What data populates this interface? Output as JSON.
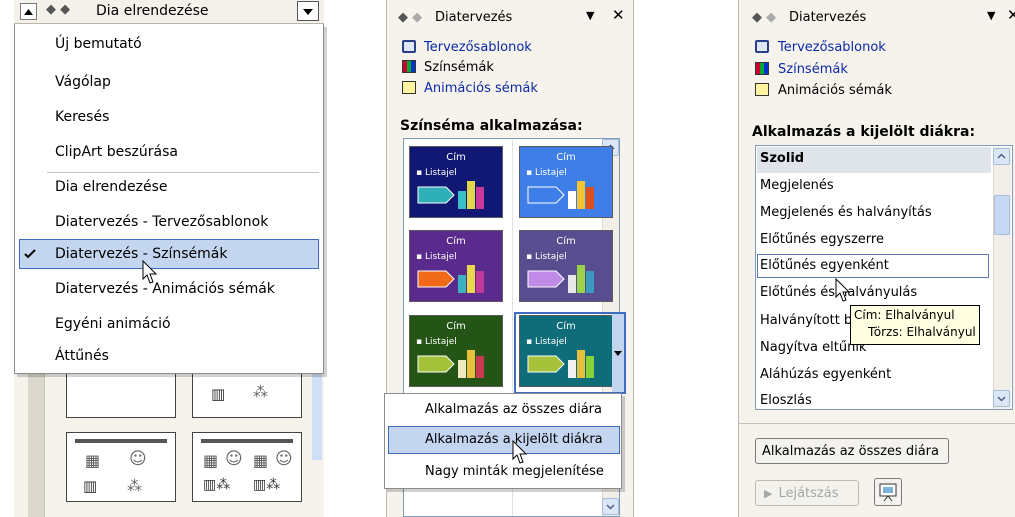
{
  "panel1": {
    "title": "Dia elrendezése",
    "menu_items": [
      "Új bemutató",
      "Vágólap",
      "Keresés",
      "ClipArt beszúrása",
      "Dia elrendezése",
      "Diatervezés - Tervezősablonok",
      "Diatervezés - Színsémák",
      "Diatervezés - Animációs sémák",
      "Egyéni animáció",
      "Áttűnés"
    ],
    "checked_index": 6
  },
  "panel2": {
    "header_title": "Diatervezés",
    "links": [
      "Tervezősablonok",
      "Színsémák",
      "Animációs sémák"
    ],
    "section_title": "Színséma alkalmazása:",
    "tile_title": "Cím",
    "tile_bullet": "Listajel",
    "context_menu": [
      "Alkalmazás az összes diára",
      "Alkalmazás a kijelölt diákra",
      "Nagy minták megjelenítése"
    ],
    "tiles": [
      {
        "bg": "#101873",
        "arrow": "#2fb0b8",
        "bars": [
          "#39c0c8",
          "#e0d84a",
          "#c83a9a"
        ]
      },
      {
        "bg": "#3f7ee6",
        "arrow": "#3f7ee6",
        "bars": [
          "#ffffff",
          "#f4c430",
          "#d9501f"
        ]
      },
      {
        "bg": "#5a2a8c",
        "arrow": "#f06a1a",
        "bars": [
          "#3ab0c0",
          "#e8d84a",
          "#c03a9a"
        ]
      },
      {
        "bg": "#584d8e",
        "arrow": "#c08ae8",
        "bars": [
          "#e8e8e8",
          "#9ad24a",
          "#3a9ac0"
        ]
      },
      {
        "bg": "#245416",
        "arrow": "#a6c23a",
        "bars": [
          "#f0e8c0",
          "#e8c040",
          "#c83a50"
        ]
      },
      {
        "bg": "#0f6d7a",
        "arrow": "#a6c23a",
        "bars": [
          "#f0f0f0",
          "#e8c040",
          "#8ad23a"
        ]
      }
    ]
  },
  "panel3": {
    "header_title": "Diatervezés",
    "links": [
      "Tervezősablonok",
      "Színsémák",
      "Animációs sémák"
    ],
    "section_title": "Alkalmazás a kijelölt diákra:",
    "list_items": [
      "Szolid",
      "Megjelenés",
      "Megjelenés és halványítás",
      "Előtűnés egyszerre",
      "Előtűnés egyenként",
      "Előtűnés és halványulás",
      "Halványított betűk",
      "Nagyítva eltűnik",
      "Aláhúzás egyenként",
      "Eloszlás"
    ],
    "tooltip": [
      "Cím: Elhalványul",
      "Törzs: Elhalványul"
    ],
    "apply_all_button": "Alkalmazás az összes diára",
    "play_button": "Lejátszás"
  },
  "colors": {
    "selection": "#c4d5ef",
    "selection_border": "#3d6cc0",
    "link": "#0b2aa6",
    "pane_bg": "#f6f3ec"
  }
}
